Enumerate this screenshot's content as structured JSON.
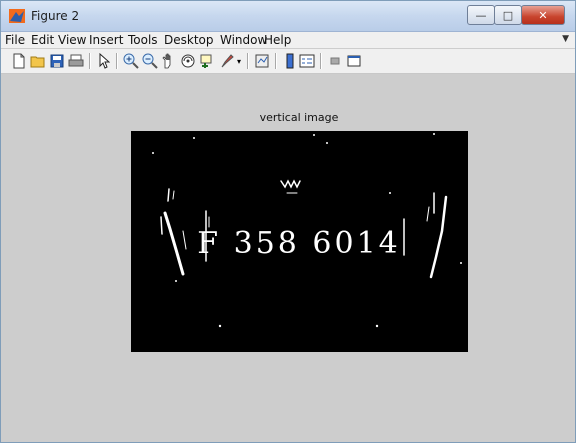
{
  "window": {
    "title": "Figure 2"
  },
  "menu": [
    "File",
    "Edit",
    "View",
    "Insert",
    "Tools",
    "Desktop",
    "Window",
    "Help"
  ],
  "toolbar": [
    "new-figure",
    "open-file",
    "save",
    "print",
    "edit-plot",
    "zoom-in",
    "zoom-out",
    "pan",
    "rotate-3d",
    "data-cursor",
    "brush",
    "link-plot",
    "insert-colorbar",
    "insert-legend",
    "hide-plot-tools",
    "show-plot-tools"
  ],
  "figure": {
    "title": "vertical image",
    "image_text": "F 358 6014"
  },
  "colors": {
    "figure_bg": "#cdcdcd",
    "axes_bg": "#000000",
    "foreground": "#ffffff"
  }
}
